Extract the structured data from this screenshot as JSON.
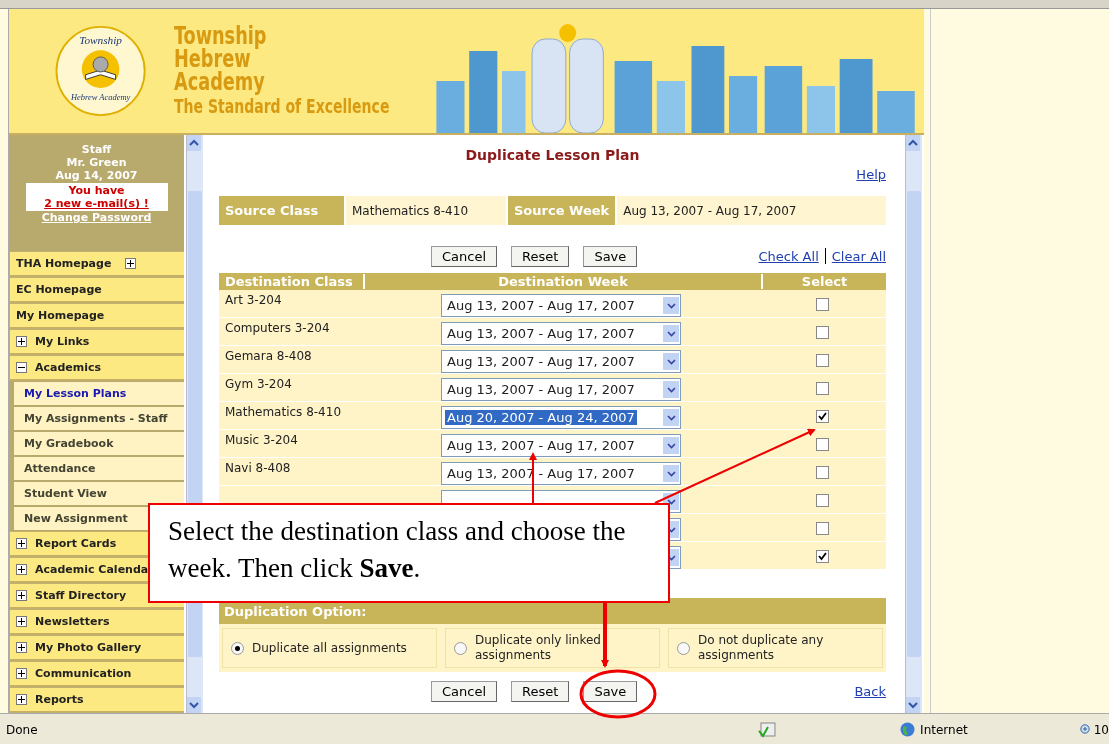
{
  "header": {
    "logo_top": "Township",
    "logo_bottom": "Hebrew Academy",
    "title_lines": [
      "Township",
      "Hebrew",
      "Academy"
    ],
    "tagline": "The Standard of Excellence"
  },
  "sidebar": {
    "profile": {
      "role": "Staff",
      "name": "Mr. Green",
      "date": "Aug 14, 2007",
      "notice": "You have",
      "mail_link": "2 new e-mail(s) !",
      "password_link": "Change Password"
    },
    "items": [
      {
        "label": "THA Homepage",
        "kind": "toggle_right",
        "expanded": false
      },
      {
        "label": "EC Homepage",
        "kind": "plain"
      },
      {
        "label": "My Homepage",
        "kind": "plain"
      },
      {
        "label": "My Links",
        "kind": "toggle",
        "expanded": false
      },
      {
        "label": "Academics",
        "kind": "toggle",
        "expanded": true,
        "children": [
          {
            "label": "My Lesson Plans",
            "selected": true
          },
          {
            "label": "My Assignments - Staff",
            "selected": false
          },
          {
            "label": "My Gradebook",
            "selected": false
          },
          {
            "label": "Attendance",
            "selected": false
          },
          {
            "label": "Student View",
            "selected": false
          },
          {
            "label": "New Assignment",
            "selected": false
          }
        ]
      },
      {
        "label": "Report Cards",
        "kind": "toggle",
        "expanded": false
      },
      {
        "label": "Academic Calenda",
        "kind": "toggle",
        "expanded": false
      },
      {
        "label": "Staff Directory",
        "kind": "toggle",
        "expanded": false
      },
      {
        "label": "Newsletters",
        "kind": "toggle",
        "expanded": false
      },
      {
        "label": "My Photo Gallery",
        "kind": "toggle",
        "expanded": false
      },
      {
        "label": "Communication",
        "kind": "toggle",
        "expanded": false
      },
      {
        "label": "Reports",
        "kind": "toggle",
        "expanded": false
      }
    ]
  },
  "main": {
    "title": "Duplicate Lesson Plan",
    "help_link": "Help",
    "source": {
      "class_label": "Source Class",
      "class_value": "Mathematics 8-410",
      "week_label": "Source Week",
      "week_value": "Aug 13, 2007 - Aug 17, 2007"
    },
    "buttons": [
      "Cancel",
      "Reset",
      "Save"
    ],
    "links": [
      "Check All",
      "Clear All"
    ],
    "table": {
      "columns": [
        "Destination Class",
        "Destination Week",
        "Select"
      ],
      "rows": [
        {
          "class": "Art 3-204",
          "week": "Aug 13, 2007 - Aug 17, 2007",
          "highlighted": false,
          "checked": false
        },
        {
          "class": "Computers 3-204",
          "week": "Aug 13, 2007 - Aug 17, 2007",
          "highlighted": false,
          "checked": false
        },
        {
          "class": "Gemara 8-408",
          "week": "Aug 13, 2007 - Aug 17, 2007",
          "highlighted": false,
          "checked": false
        },
        {
          "class": "Gym 3-204",
          "week": "Aug 13, 2007 - Aug 17, 2007",
          "highlighted": false,
          "checked": false
        },
        {
          "class": "Mathematics 8-410",
          "week": "Aug 20, 2007 - Aug 24, 2007",
          "highlighted": true,
          "checked": true
        },
        {
          "class": "Music 3-204",
          "week": "Aug 13, 2007 - Aug 17, 2007",
          "highlighted": false,
          "checked": false
        },
        {
          "class": "Navi 8-408",
          "week": "Aug 13, 2007 - Aug 17, 2007",
          "highlighted": false,
          "checked": false
        },
        {
          "checked": false
        },
        {
          "checked": false
        },
        {
          "checked": true
        }
      ]
    },
    "duplication": {
      "heading": "Duplication Option:",
      "options": [
        {
          "label": "Duplicate all assignments",
          "selected": true
        },
        {
          "label": "Duplicate only linked assignments",
          "selected": false
        },
        {
          "label": "Do not duplicate any assignments",
          "selected": false
        }
      ]
    },
    "bottom_buttons": [
      "Cancel",
      "Reset",
      "Save"
    ],
    "back_link": "Back"
  },
  "callout": {
    "text": "Select the destination class and choose the week.  Then click **Save**."
  },
  "status_bar": {
    "status": "Done",
    "zone": "Internet",
    "zoom": "10"
  }
}
